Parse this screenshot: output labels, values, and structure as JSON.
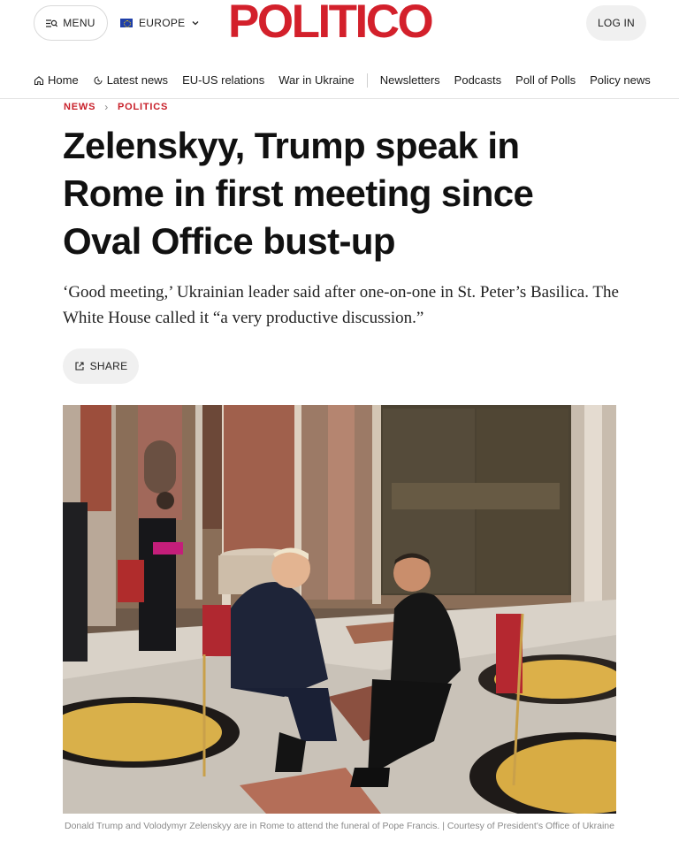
{
  "header": {
    "menu_label": "MENU",
    "edition_label": "EUROPE",
    "logo_text": "POLITICO",
    "login_label": "LOG IN",
    "brand_color": "#d3202b"
  },
  "nav": {
    "items": [
      {
        "label": "Home",
        "icon": "home-icon"
      },
      {
        "label": "Latest news",
        "icon": "clock-icon"
      },
      {
        "label": "EU-US relations"
      },
      {
        "label": "War in Ukraine"
      },
      {
        "label": "Newsletters"
      },
      {
        "label": "Podcasts"
      },
      {
        "label": "Poll of Polls"
      },
      {
        "label": "Policy news"
      }
    ]
  },
  "article": {
    "breadcrumb": [
      "NEWS",
      "POLITICS"
    ],
    "headline": "Zelenskyy, Trump speak in Rome in first meeting since Oval Office bust-up",
    "dek": "‘Good meeting,’ Ukrainian leader said after one-on-one in St. Peter’s Basilica. The White House called it “a very productive discussion.”",
    "share_label": "SHARE",
    "photo_caption": "Donald Trump and Volodymyr Zelenskyy are in Rome to attend the funeral of Pope Francis. | Courtesy of President's Office of Ukraine"
  }
}
